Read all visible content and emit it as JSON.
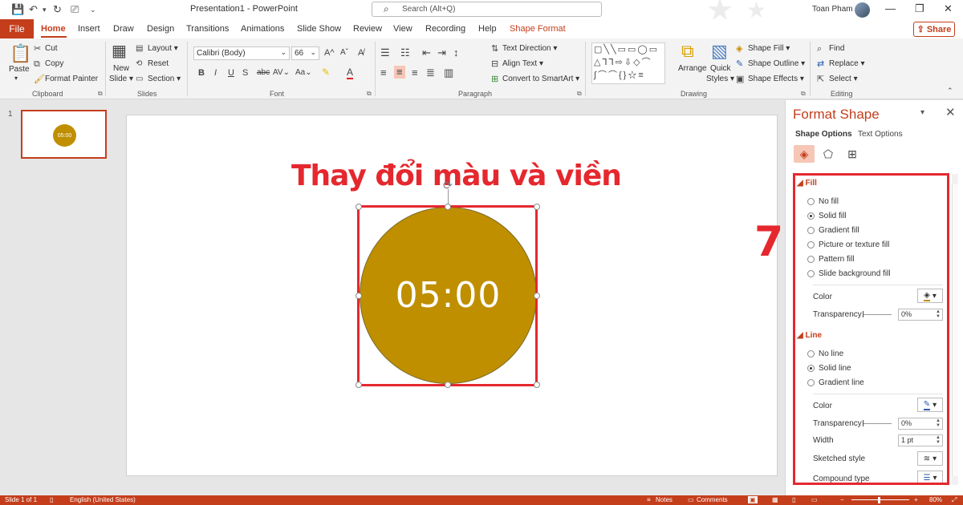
{
  "titlebar": {
    "doc_title": "Presentation1  -  PowerPoint",
    "search_placeholder": "Search (Alt+Q)",
    "user_name": "Toan Pham",
    "minimize": "—",
    "restore": "❐",
    "close": "✕"
  },
  "tabs": {
    "file": "File",
    "items": [
      "Home",
      "Insert",
      "Draw",
      "Design",
      "Transitions",
      "Animations",
      "Slide Show",
      "Review",
      "View",
      "Recording",
      "Help",
      "Shape Format"
    ],
    "share": "Share"
  },
  "ribbon": {
    "clipboard": {
      "paste": "Paste",
      "cut": "Cut",
      "copy": "Copy",
      "format_painter": "Format Painter",
      "label": "Clipboard"
    },
    "slides": {
      "new_slide": "New",
      "new_slide2": "Slide ▾",
      "layout": "Layout ▾",
      "reset": "Reset",
      "section": "Section ▾",
      "label": "Slides"
    },
    "font": {
      "family": "Calibri (Body)",
      "size": "66",
      "label": "Font"
    },
    "paragraph": {
      "text_direction": "Text Direction ▾",
      "align_text": "Align Text ▾",
      "smartart": "Convert to SmartArt ▾",
      "label": "Paragraph"
    },
    "drawing": {
      "arrange": "Arrange",
      "quick_styles": "Quick",
      "quick_styles2": "Styles ▾",
      "shape_fill": "Shape Fill ▾",
      "shape_outline": "Shape Outline ▾",
      "shape_effects": "Shape Effects ▾",
      "label": "Drawing"
    },
    "editing": {
      "find": "Find",
      "replace": "Replace ▾",
      "select": "Select ▾",
      "label": "Editing"
    }
  },
  "thumbnails": {
    "number": "1",
    "timer": "05:00"
  },
  "slide": {
    "heading": "Thay đổi màu và viền",
    "timer": "05:00",
    "circle_color": "#bf8f00"
  },
  "annotation": {
    "step": "7"
  },
  "format_pane": {
    "title": "Format Shape",
    "tab_shape": "Shape Options",
    "tab_text": "Text Options",
    "fill": {
      "title": "Fill",
      "options": [
        "No fill",
        "Solid fill",
        "Gradient fill",
        "Picture or texture fill",
        "Pattern fill",
        "Slide background fill"
      ],
      "selected": 1,
      "color_label": "Color",
      "transparency_label": "Transparency",
      "transparency_value": "0%"
    },
    "line": {
      "title": "Line",
      "options": [
        "No line",
        "Solid line",
        "Gradient line"
      ],
      "selected": 1,
      "color_label": "Color",
      "transparency_label": "Transparency",
      "transparency_value": "0%",
      "width_label": "Width",
      "width_value": "1 pt",
      "sketched_label": "Sketched style",
      "compound_label": "Compound type"
    }
  },
  "statusbar": {
    "slide_info": "Slide 1 of 1",
    "language": "English (United States)",
    "notes": "Notes",
    "comments": "Comments",
    "zoom": "80%"
  },
  "colors": {
    "accent": "#c43e1c",
    "annotation_red": "#e5282e",
    "shape_fill": "#bf8f00"
  }
}
